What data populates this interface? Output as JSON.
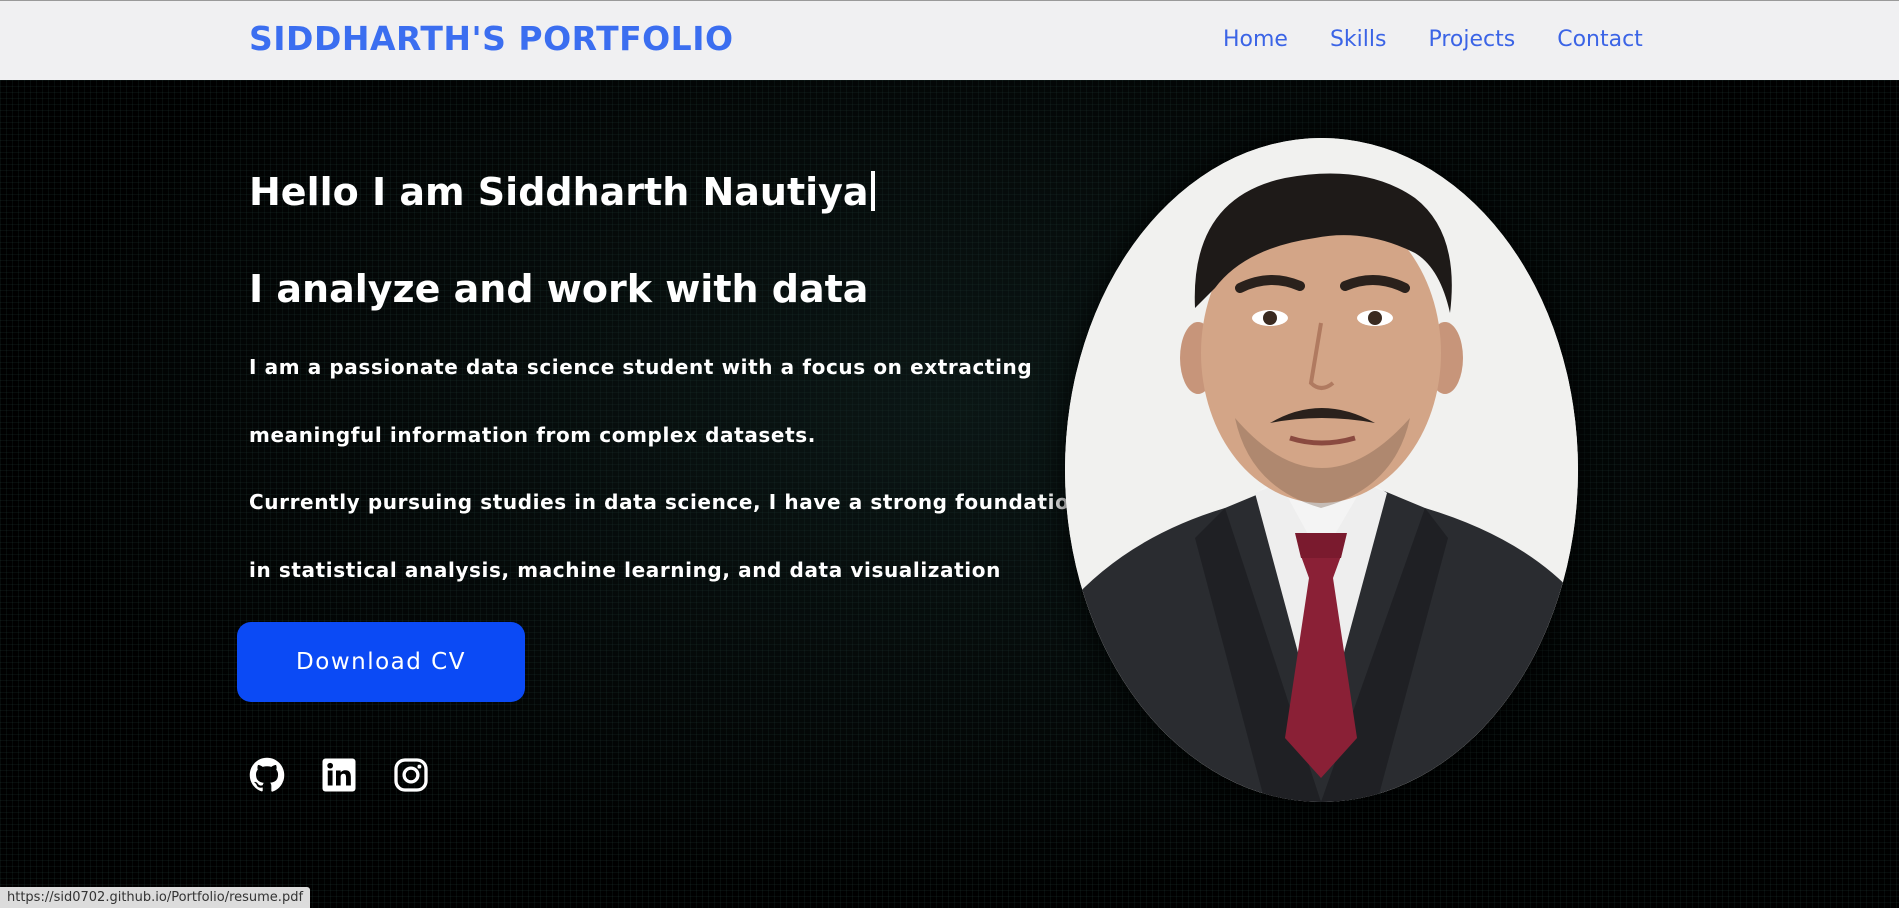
{
  "navbar": {
    "brand": "SIDDHARTH'S PORTFOLIO",
    "links": [
      "Home",
      "Skills",
      "Projects",
      "Contact"
    ]
  },
  "hero": {
    "greeting": "Hello I am Siddharth Nautiya",
    "tagline": "I analyze and work with data",
    "paragraph_lines": [
      "I am a passionate data science student with a focus on extracting",
      "meaningful information from complex datasets.",
      "Currently pursuing studies in data science, I have a strong foundation",
      "in statistical analysis, machine learning, and data visualization"
    ],
    "cv_button": "Download CV",
    "social_icons": [
      "github-icon",
      "linkedin-icon",
      "instagram-icon"
    ],
    "photo": "profile-photo"
  },
  "status_url": "https://sid0702.github.io/Portfolio/resume.pdf",
  "colors": {
    "brand": "#3b6ef0",
    "nav_link": "#3b64e6",
    "cv_button": "#0b4af5",
    "background": "#000000"
  }
}
